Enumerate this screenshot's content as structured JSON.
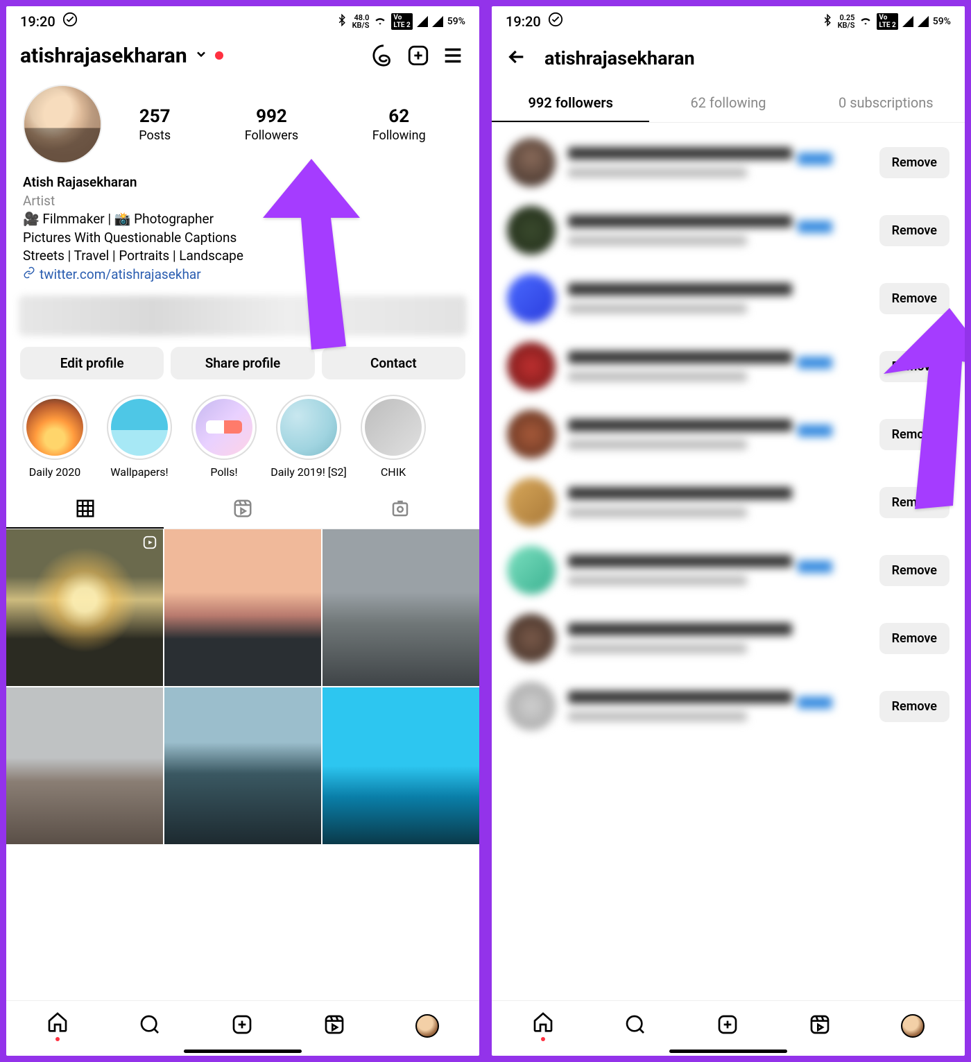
{
  "left": {
    "status": {
      "time": "19:20",
      "net_rate": "48.0",
      "net_unit": "KB/S",
      "battery": "59%"
    },
    "username": "atishrajasekharan",
    "stats": {
      "posts": {
        "value": "257",
        "label": "Posts"
      },
      "followers": {
        "value": "992",
        "label": "Followers"
      },
      "following": {
        "value": "62",
        "label": "Following"
      }
    },
    "bio": {
      "name": "Atish Rajasekharan",
      "category": "Artist",
      "line1": "🎥 Filmmaker | 📸 Photographer",
      "line2": "Pictures With Questionable Captions",
      "line3": "Streets | Travel | Portraits | Landscape",
      "link": "twitter.com/atishrajasekhar"
    },
    "actions": {
      "edit": "Edit profile",
      "share": "Share profile",
      "contact": "Contact"
    },
    "highlights": [
      {
        "label": "Daily 2020"
      },
      {
        "label": "Wallpapers!"
      },
      {
        "label": "Polls!"
      },
      {
        "label": "Daily 2019! [S2]"
      },
      {
        "label": "CHIK"
      }
    ]
  },
  "right": {
    "status": {
      "time": "19:20",
      "net_rate": "0.25",
      "net_unit": "KB/S",
      "battery": "59%"
    },
    "title": "atishrajasekharan",
    "tabs": {
      "followers": "992 followers",
      "following": "62 following",
      "subs": "0 subscriptions"
    },
    "remove_label": "Remove"
  }
}
